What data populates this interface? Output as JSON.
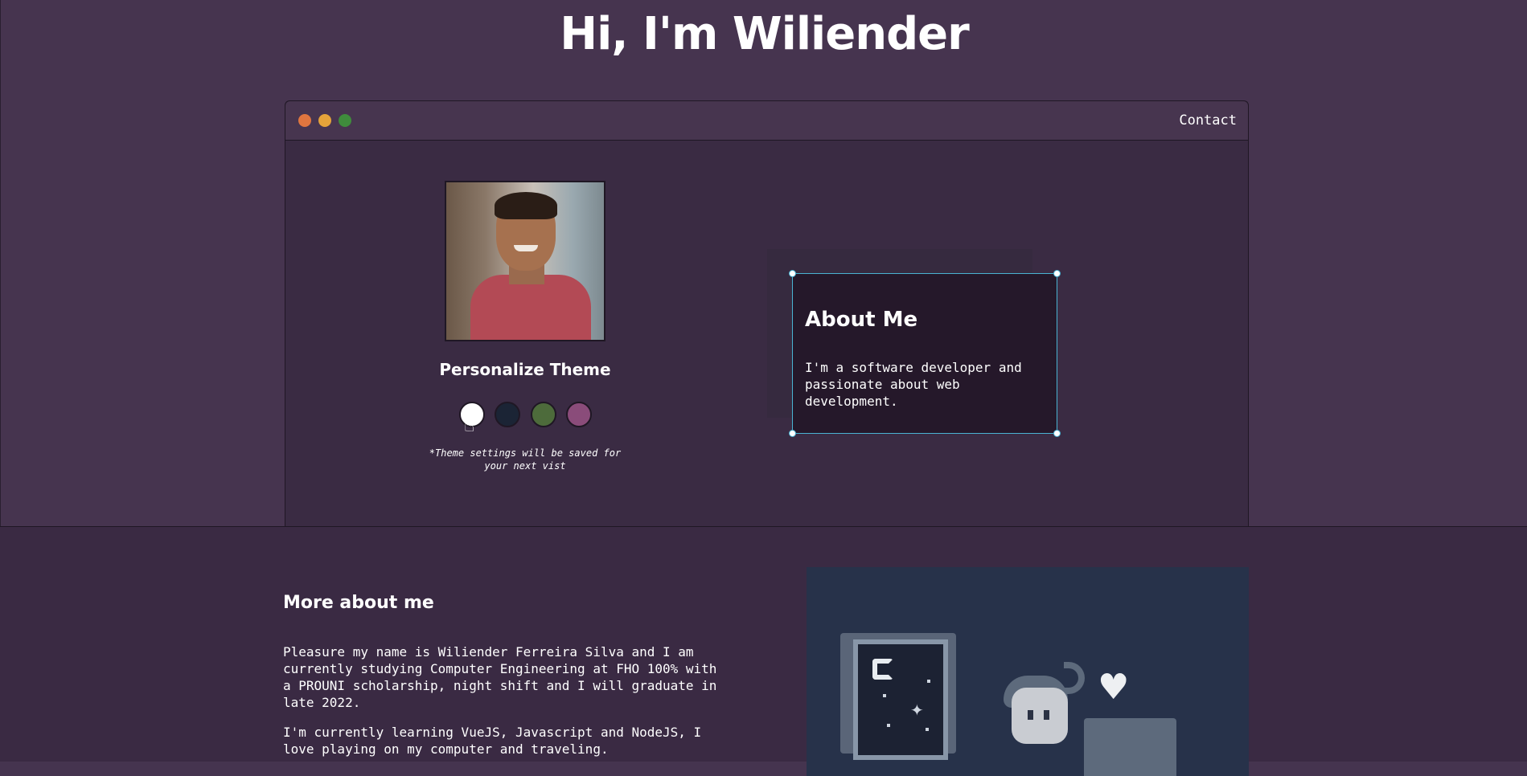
{
  "hero": {
    "title": "Hi, I'm Wiliender"
  },
  "window": {
    "nav_contact": "Contact"
  },
  "profile": {
    "avatar_alt": "Profile photo",
    "theme_title": "Personalize Theme",
    "theme_note": "*Theme settings will be saved for your next vist",
    "themes": [
      {
        "name": "white",
        "color": "#ffffff"
      },
      {
        "name": "navy",
        "color": "#1b2435"
      },
      {
        "name": "green",
        "color": "#4d6b3b"
      },
      {
        "name": "purple",
        "color": "#8a4c7a"
      }
    ]
  },
  "about": {
    "title": "About Me",
    "text": "I'm a software developer and passionate about web development."
  },
  "more": {
    "title": "More about me",
    "paragraph1": "Pleasure my name is Wiliender Ferreira Silva and I am currently studying Computer Engineering at FHO 100% with a PROUNI scholarship, night shift and I will graduate in late 2022.",
    "paragraph2": "I'm currently learning VueJS, Javascript and NodeJS, I love playing on my computer and traveling."
  },
  "colors": {
    "page_bg": "#46344f",
    "window_bg": "#3a2b43",
    "card_bg": "#25182a",
    "selection_outline": "#4ab3d2"
  }
}
